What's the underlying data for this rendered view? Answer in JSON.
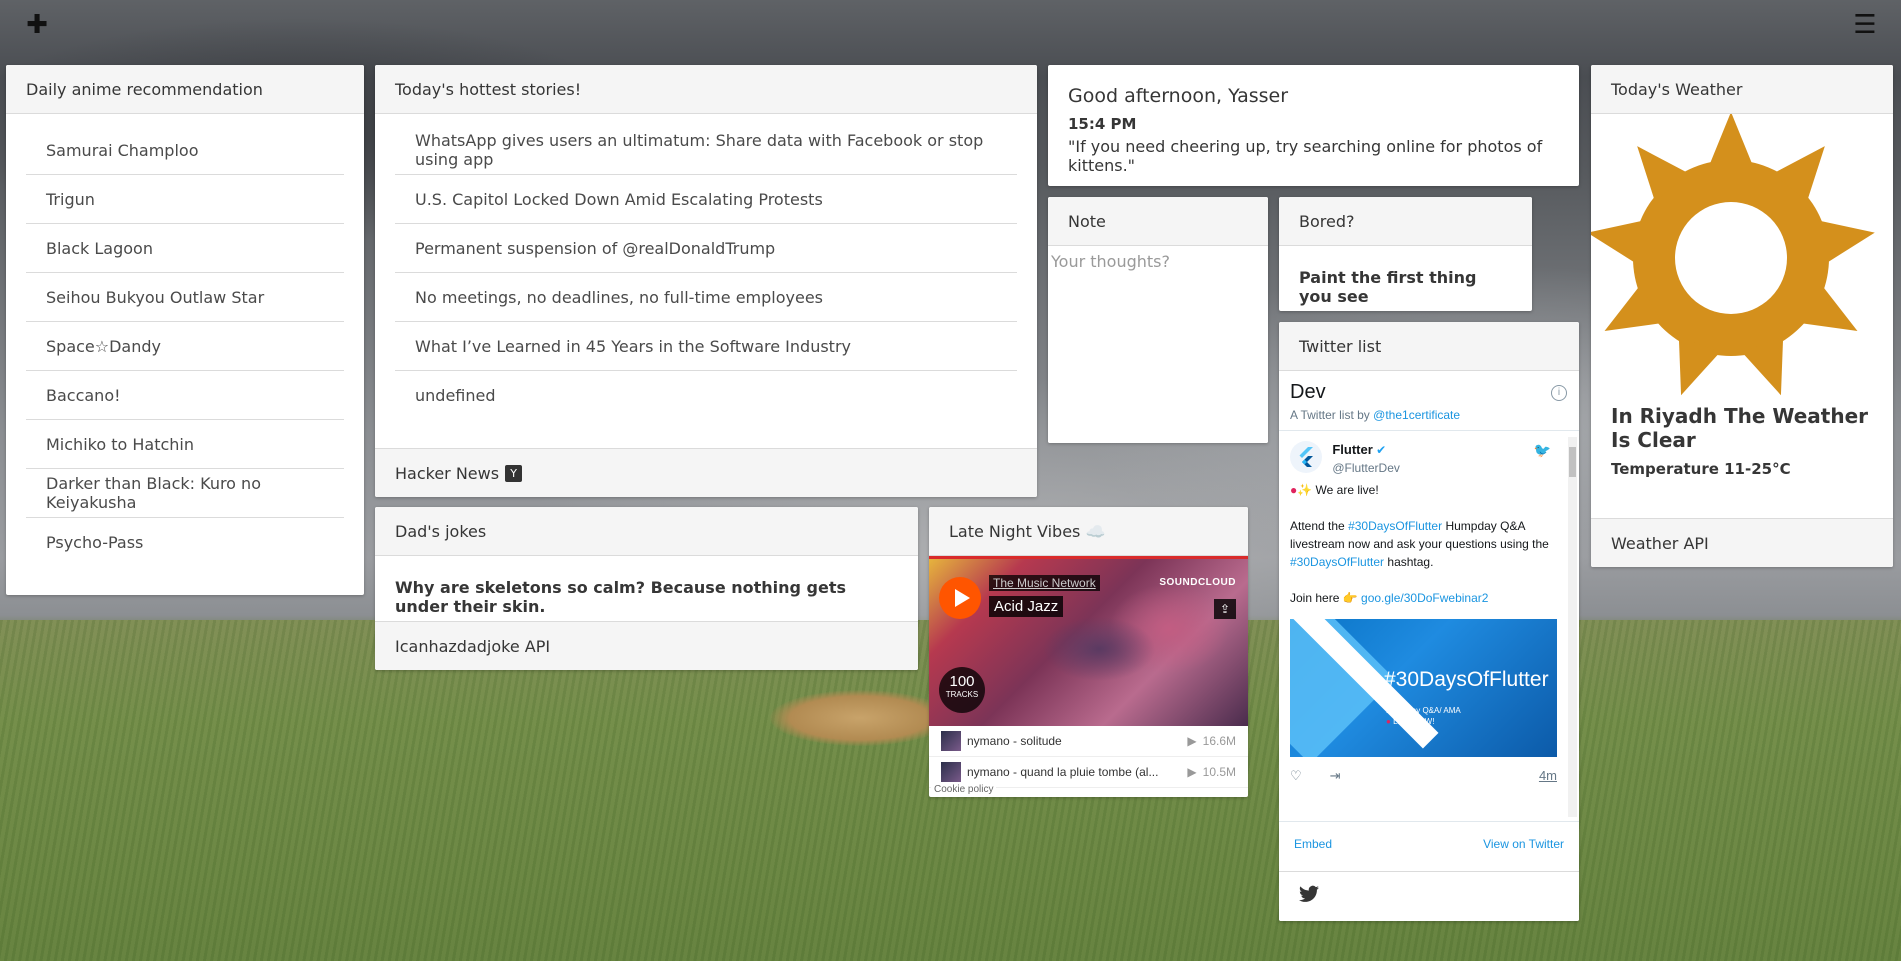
{
  "topbar": {
    "add_icon": "plus-icon",
    "menu_icon": "hamburger-menu-icon"
  },
  "anime": {
    "title": "Daily anime recommendation",
    "items": [
      "Samurai Champloo",
      "Trigun",
      "Black Lagoon",
      "Seihou Bukyou Outlaw Star",
      "Space☆Dandy",
      "Baccano!",
      "Michiko to Hatchin",
      "Darker than Black: Kuro no Keiyakusha",
      "Psycho-Pass"
    ]
  },
  "stories": {
    "title": "Today's hottest stories!",
    "items": [
      "WhatsApp gives users an ultimatum: Share data with Facebook or stop using app",
      "U.S. Capitol Locked Down Amid Escalating Protests",
      "Permanent suspension of @realDonaldTrump",
      "No meetings, no deadlines, no full-time employees",
      "What I’ve Learned in 45 Years in the Software Industry",
      "undefined"
    ],
    "footer": "Hacker News",
    "footer_badge": "Y"
  },
  "greeting": {
    "title": "Good afternoon, Yasser",
    "time": "15:4 PM",
    "quote": "\"If you need cheering up, try searching online for photos of kittens.\""
  },
  "note": {
    "title": "Note",
    "placeholder": "Your thoughts?"
  },
  "bored": {
    "title": "Bored?",
    "activity": "Paint the first thing you see"
  },
  "weather": {
    "title": "Today's Weather",
    "icon": "sun-icon",
    "icon_color": "#d4901c",
    "headline": "In Riyadh The Weather Is Clear",
    "temperature": "Temperature 11-25°C",
    "footer": "Weather API"
  },
  "jokes": {
    "title": "Dad's jokes",
    "joke": "Why are skeletons so calm? Because nothing gets under their skin.",
    "footer": "Icanhazdadjoke API"
  },
  "music": {
    "title": "Late Night Vibes ☁️",
    "user": "The Music Network",
    "playlist": "Acid Jazz",
    "logo": "SOUNDCLOUD",
    "track_count": "100",
    "track_label": "TRACKS",
    "tracks": [
      {
        "name": "nymano - solitude",
        "plays": "16.6M"
      },
      {
        "name": "nymano - quand la pluie tombe (al...",
        "plays": "10.5M"
      }
    ],
    "cookie": "Cookie policy"
  },
  "twitter": {
    "title": "Twitter list",
    "list_name": "Dev",
    "by_prefix": "A Twitter list by",
    "by_user": "@the1certificate",
    "tweet": {
      "name": "Flutter",
      "handle": "@FlutterDev",
      "line1": "We are live!",
      "line2a": "Attend the",
      "tag1": "#30DaysOfFlutter",
      "line2b": "Humpday Q&A livestream now and ask your questions using the",
      "tag2": "#30DaysOfFlutter",
      "line2c": "hashtag.",
      "line3": "Join here",
      "link": "goo.gle/30DoFwebinar2",
      "image_title": "#30DaysOfFlutter",
      "image_sub1": "Humpday Q&A/ AMA",
      "image_sub2": "LIVE NOW!",
      "age": "4m"
    },
    "embed": "Embed",
    "view": "View on Twitter",
    "accent": "#1b95e0"
  }
}
